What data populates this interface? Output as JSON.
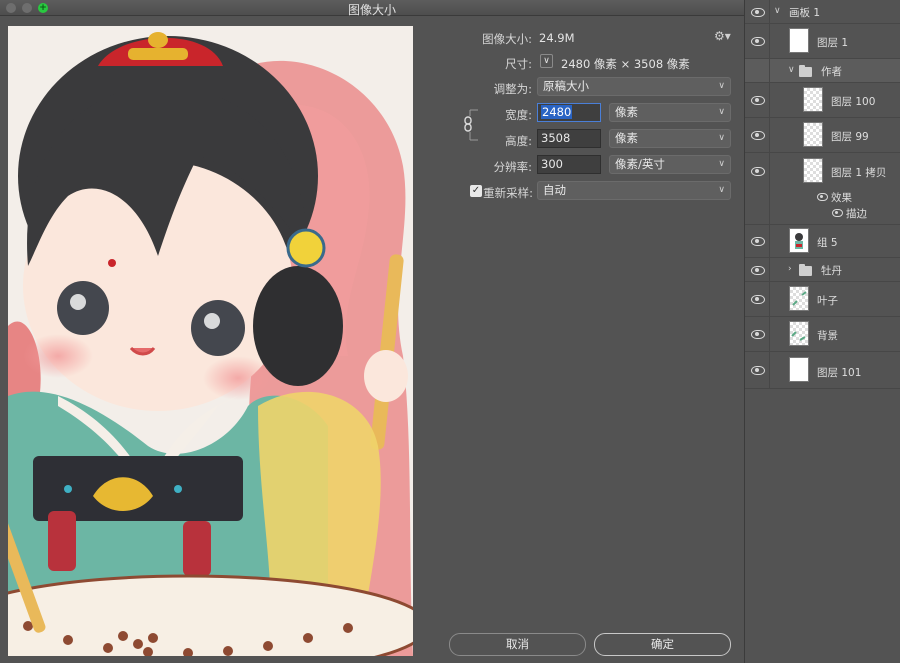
{
  "dialog": {
    "title": "图像大小",
    "image_size_label": "图像大小:",
    "image_size_value": "24.9M",
    "dimensions_label": "尺寸:",
    "dimensions_value": "2480 像素  ×  3508 像素",
    "fit_to_label": "调整为:",
    "fit_to_value": "原稿大小",
    "width_label": "宽度:",
    "width_value": "2480",
    "width_unit": "像素",
    "height_label": "高度:",
    "height_value": "3508",
    "height_unit": "像素",
    "resolution_label": "分辨率:",
    "resolution_value": "300",
    "resolution_unit": "像素/英寸",
    "resample_label": "重新采样:",
    "resample_checked": true,
    "resample_value": "自动",
    "cancel_label": "取消",
    "ok_label": "确定"
  },
  "layers": {
    "items": [
      {
        "name": "画板 1",
        "kind": "artboard"
      },
      {
        "name": "图层 1",
        "kind": "layer"
      },
      {
        "name": "作者",
        "kind": "group"
      },
      {
        "name": "图层 100",
        "kind": "layer"
      },
      {
        "name": "图层 99",
        "kind": "layer"
      },
      {
        "name": "图层 1 拷贝",
        "kind": "layer"
      },
      {
        "name": "效果",
        "kind": "effect"
      },
      {
        "name": "描边",
        "kind": "effect"
      },
      {
        "name": "组 5",
        "kind": "layer"
      },
      {
        "name": "牡丹",
        "kind": "group"
      },
      {
        "name": "叶子",
        "kind": "layer"
      },
      {
        "name": "背景",
        "kind": "layer"
      },
      {
        "name": "图层 101",
        "kind": "layer"
      }
    ]
  },
  "colors": {
    "accent_selection": "#2a64c4",
    "traffic_light_green": "#29c940"
  }
}
